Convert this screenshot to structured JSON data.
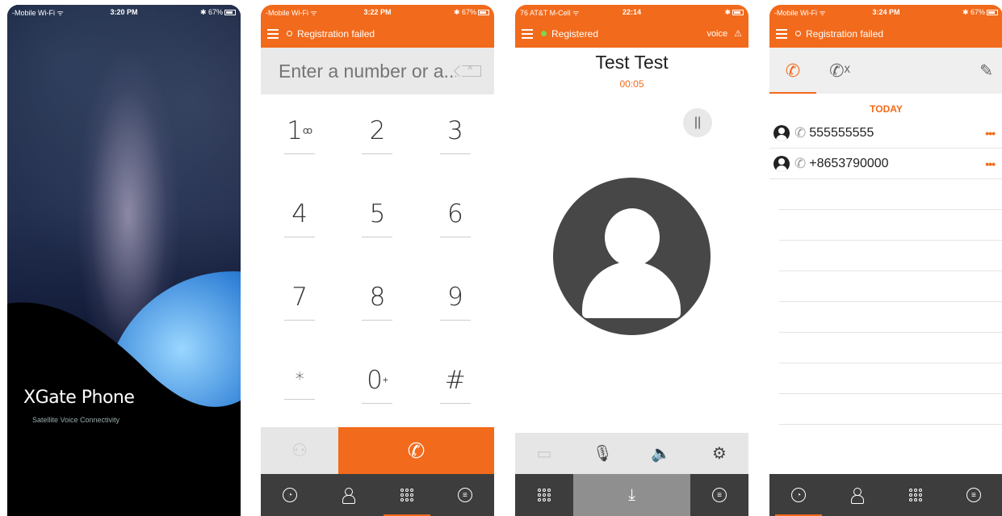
{
  "splash": {
    "status": {
      "carrier": "-Mobile Wi-Fi ᯤ",
      "time": "3:20 PM",
      "battery": "✱ 67%"
    },
    "app_name": "XGate Phone",
    "tagline": "Satellite Voice Connectivity"
  },
  "dialer": {
    "status": {
      "carrier": "-Mobile Wi-Fi ᯤ",
      "time": "3:22 PM",
      "battery": "✱ 67%"
    },
    "registration": "Registration failed",
    "input_placeholder": "Enter a number or a...",
    "keys": [
      {
        "digit": "1",
        "sub": "ꝏ"
      },
      {
        "digit": "2",
        "sub": ""
      },
      {
        "digit": "3",
        "sub": ""
      },
      {
        "digit": "4",
        "sub": ""
      },
      {
        "digit": "5",
        "sub": ""
      },
      {
        "digit": "6",
        "sub": ""
      },
      {
        "digit": "7",
        "sub": ""
      },
      {
        "digit": "8",
        "sub": ""
      },
      {
        "digit": "9",
        "sub": ""
      },
      {
        "digit": "*",
        "sub": ""
      },
      {
        "digit": "0",
        "sub": "+"
      },
      {
        "digit": "#",
        "sub": ""
      }
    ],
    "tabs": [
      "recents-icon",
      "contacts-icon",
      "keypad-icon",
      "chat-icon"
    ],
    "active_tab": "keypad"
  },
  "in_call": {
    "status": {
      "carrier": "76 AT&T M-Cell ᯤ",
      "time": "22:14",
      "battery": "✱"
    },
    "registration": "Registered",
    "voice_label": "voice",
    "callee_name": "Test Test",
    "duration": "00:05",
    "hold_symbol": "||"
  },
  "recents": {
    "status": {
      "carrier": "-Mobile Wi-Fi ᯤ",
      "time": "3:24 PM",
      "battery": "✱ 67%"
    },
    "registration": "Registration failed",
    "section_header": "TODAY",
    "calls": [
      {
        "number": "555555555",
        "more": "•••"
      },
      {
        "number": "+8653790000",
        "more": "•••"
      }
    ]
  },
  "colors": {
    "accent": "#f26a1b",
    "tabbar": "#3d3d3d"
  }
}
